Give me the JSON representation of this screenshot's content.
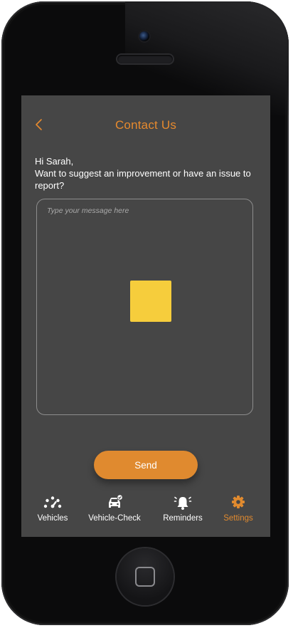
{
  "header": {
    "title": "Contact Us",
    "back_icon": "chevron-left-icon"
  },
  "greeting": {
    "line1": "Hi Sarah,",
    "line2": "Want to suggest an improvement or have an issue to report?"
  },
  "message": {
    "value": "",
    "placeholder": "Type your message here"
  },
  "send_label": "Send",
  "tabs": [
    {
      "label": "Vehicles",
      "icon": "gauge-icon",
      "active": false
    },
    {
      "label": "Vehicle-Check",
      "icon": "car-check-icon",
      "active": false
    },
    {
      "label": "Reminders",
      "icon": "bell-icon",
      "active": false
    },
    {
      "label": "Settings",
      "icon": "gear-icon",
      "active": true
    }
  ],
  "colors": {
    "accent": "#e08a2f",
    "screen_bg": "#464646",
    "highlight": "#f6cd3c",
    "text": "#ffffff"
  }
}
